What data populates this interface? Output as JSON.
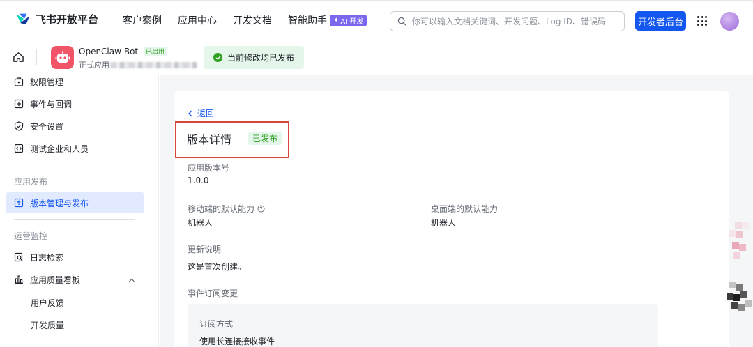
{
  "topbar": {
    "brand_name": "飞书开放平台",
    "nav": [
      {
        "label": "客户案例"
      },
      {
        "label": "应用中心"
      },
      {
        "label": "开发文档"
      },
      {
        "label": "智能助手",
        "badge": "AI 开发"
      }
    ],
    "search_placeholder": "你可以输入文档关键词、开发问题、Log ID、错误码",
    "dev_console_label": "开发者后台",
    "brand_color": "#1456f0"
  },
  "appbar": {
    "app_name": "OpenClaw-Bot",
    "enabled_badge": "已启用",
    "app_type": "正式应用",
    "toast": "当前修改均已发布"
  },
  "sidebar": {
    "items_top": [
      {
        "label": "权限管理",
        "icon": "permission-icon"
      },
      {
        "label": "事件与回调",
        "icon": "event-icon"
      },
      {
        "label": "安全设置",
        "icon": "shield-icon"
      },
      {
        "label": "测试企业和人员",
        "icon": "code-icon"
      }
    ],
    "group_publish": "应用发布",
    "publish_item": "版本管理与发布",
    "group_monitor": "运营监控",
    "monitor_items": [
      {
        "label": "日志检索",
        "icon": "log-search-icon"
      },
      {
        "label": "应用质量看板",
        "icon": "chart-icon"
      }
    ],
    "sub_items": [
      "用户反馈",
      "开发质量"
    ]
  },
  "detail": {
    "back_label": "返回",
    "title": "版本详情",
    "status": "已发布",
    "version_label": "应用版本号",
    "version_value": "1.0.0",
    "mobile_label": "移动端的默认能力",
    "mobile_value": "机器人",
    "desktop_label": "桌面端的默认能力",
    "desktop_value": "机器人",
    "notes_label": "更新说明",
    "notes_value": "这是首次创建。",
    "events_label": "事件订阅变更",
    "subscription_method_label": "订阅方式",
    "subscription_method_value": "使用长连接接收事件"
  }
}
